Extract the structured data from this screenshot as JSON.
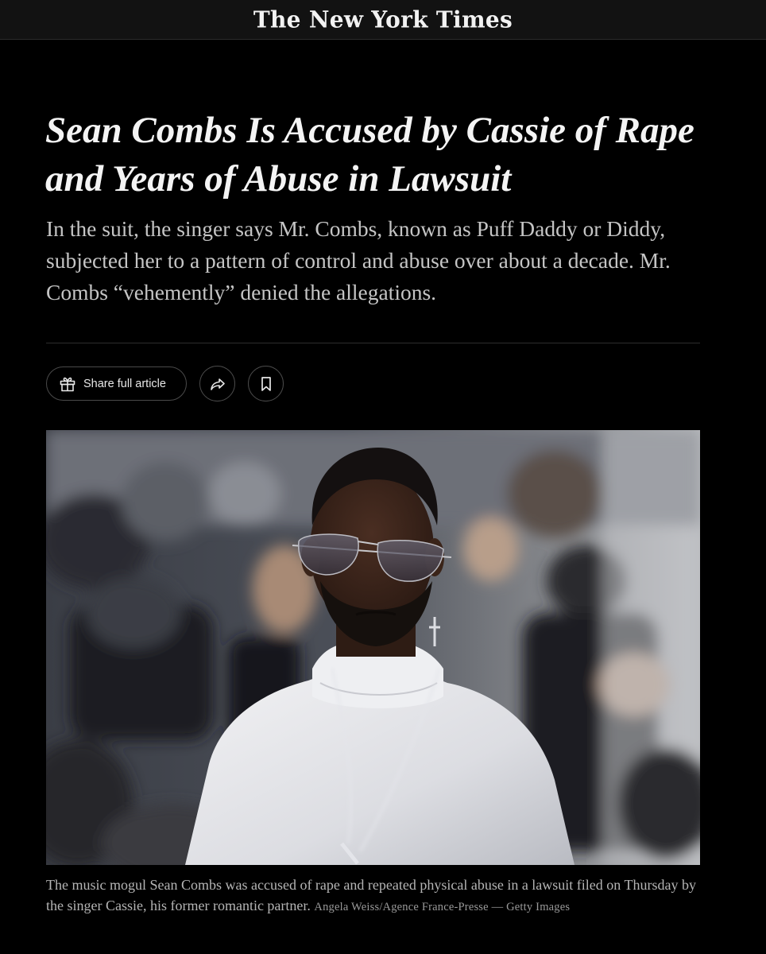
{
  "masthead": {
    "logo": "The New York Times"
  },
  "article": {
    "headline": "Sean Combs Is Accused by Cassie of Rape and Years of Abuse in Lawsuit",
    "summary": "In the suit, the singer says Mr. Combs, known as Puff Daddy or Diddy, subjected her to a pattern of control and abuse over about a decade. Mr. Combs “vehemently” denied the allegations.",
    "share": {
      "share_full_label": "Share full article",
      "gift_icon": "gift-icon",
      "share_icon": "share-arrow-icon",
      "bookmark_icon": "bookmark-icon"
    },
    "image": {
      "caption": "The music mogul Sean Combs was accused of rape and repeated physical abuse in a lawsuit filed on Thursday by the singer Cassie, his former romantic partner.",
      "credit": "Angela Weiss/Agence France-Presse — Getty Images"
    }
  },
  "colors": {
    "background": "#000000",
    "masthead_bg": "#121212",
    "headline": "#f4f4f4",
    "summary": "#c5c5c5",
    "caption": "#b5b5b5"
  }
}
